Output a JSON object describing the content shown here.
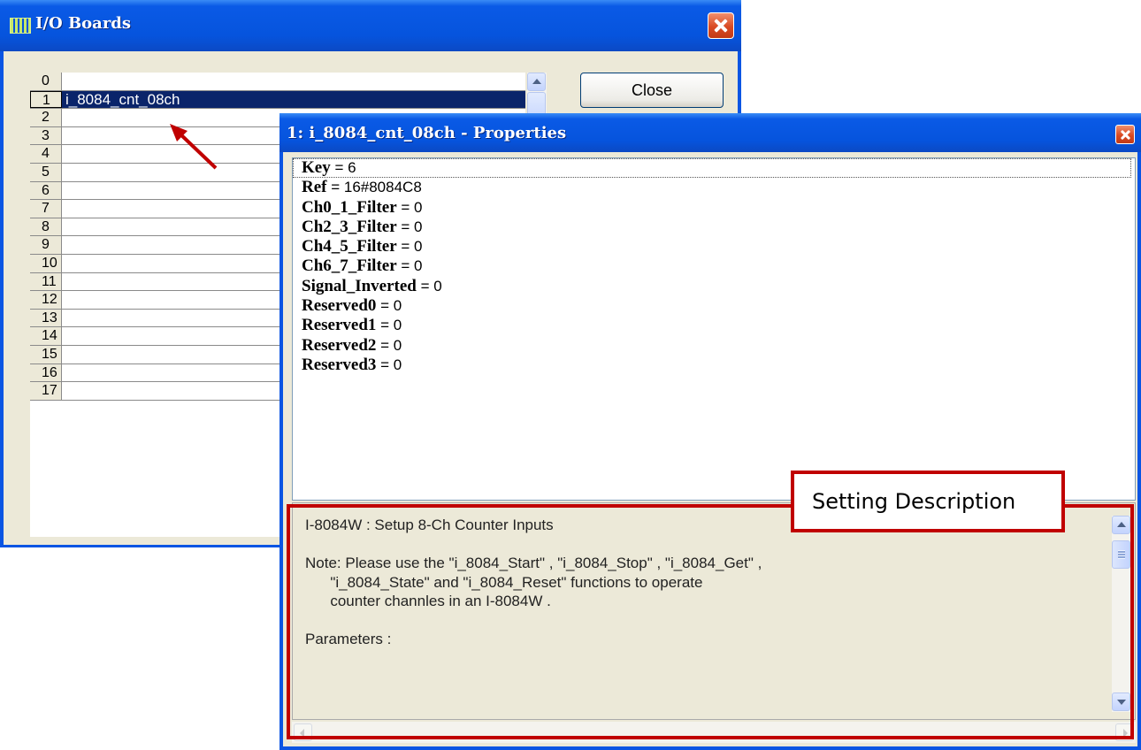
{
  "io_window": {
    "title": "I/O Boards",
    "close_button": "Close",
    "rows": [
      {
        "num": "0",
        "name": ""
      },
      {
        "num": "1",
        "name": "i_8084_cnt_08ch",
        "selected": true
      },
      {
        "num": "2",
        "name": ""
      },
      {
        "num": "3",
        "name": ""
      },
      {
        "num": "4",
        "name": ""
      },
      {
        "num": "5",
        "name": ""
      },
      {
        "num": "6",
        "name": ""
      },
      {
        "num": "7",
        "name": ""
      },
      {
        "num": "8",
        "name": ""
      },
      {
        "num": "9",
        "name": ""
      },
      {
        "num": "10",
        "name": ""
      },
      {
        "num": "11",
        "name": ""
      },
      {
        "num": "12",
        "name": ""
      },
      {
        "num": "13",
        "name": ""
      },
      {
        "num": "14",
        "name": ""
      },
      {
        "num": "15",
        "name": ""
      },
      {
        "num": "16",
        "name": ""
      },
      {
        "num": "17",
        "name": ""
      }
    ]
  },
  "props_window": {
    "title": "1: i_8084_cnt_08ch - Properties",
    "properties": [
      {
        "key": "Key",
        "value": "6"
      },
      {
        "key": "Ref",
        "value": "16#8084C8"
      },
      {
        "key": "Ch0_1_Filter",
        "value": "0"
      },
      {
        "key": "Ch2_3_Filter",
        "value": "0"
      },
      {
        "key": "Ch4_5_Filter",
        "value": "0"
      },
      {
        "key": "Ch6_7_Filter",
        "value": "0"
      },
      {
        "key": "Signal_Inverted",
        "value": "0"
      },
      {
        "key": "Reserved0",
        "value": "0"
      },
      {
        "key": "Reserved1",
        "value": "0"
      },
      {
        "key": "Reserved2",
        "value": "0"
      },
      {
        "key": "Reserved3",
        "value": "0"
      }
    ],
    "description": "I-8084W : Setup 8-Ch Counter Inputs\n\nNote: Please use the \"i_8084_Start\" , \"i_8084_Stop\" , \"i_8084_Get\" ,\n      \"i_8084_State\" and \"i_8084_Reset\" functions to operate\n      counter channles in an I-8084W .\n\nParameters :"
  },
  "annotation": {
    "label": "Setting Description"
  },
  "colors": {
    "titlebar": "#0654dd",
    "selection": "#0a246a",
    "annotation": "#c00000",
    "client_bg": "#ece9d8"
  }
}
